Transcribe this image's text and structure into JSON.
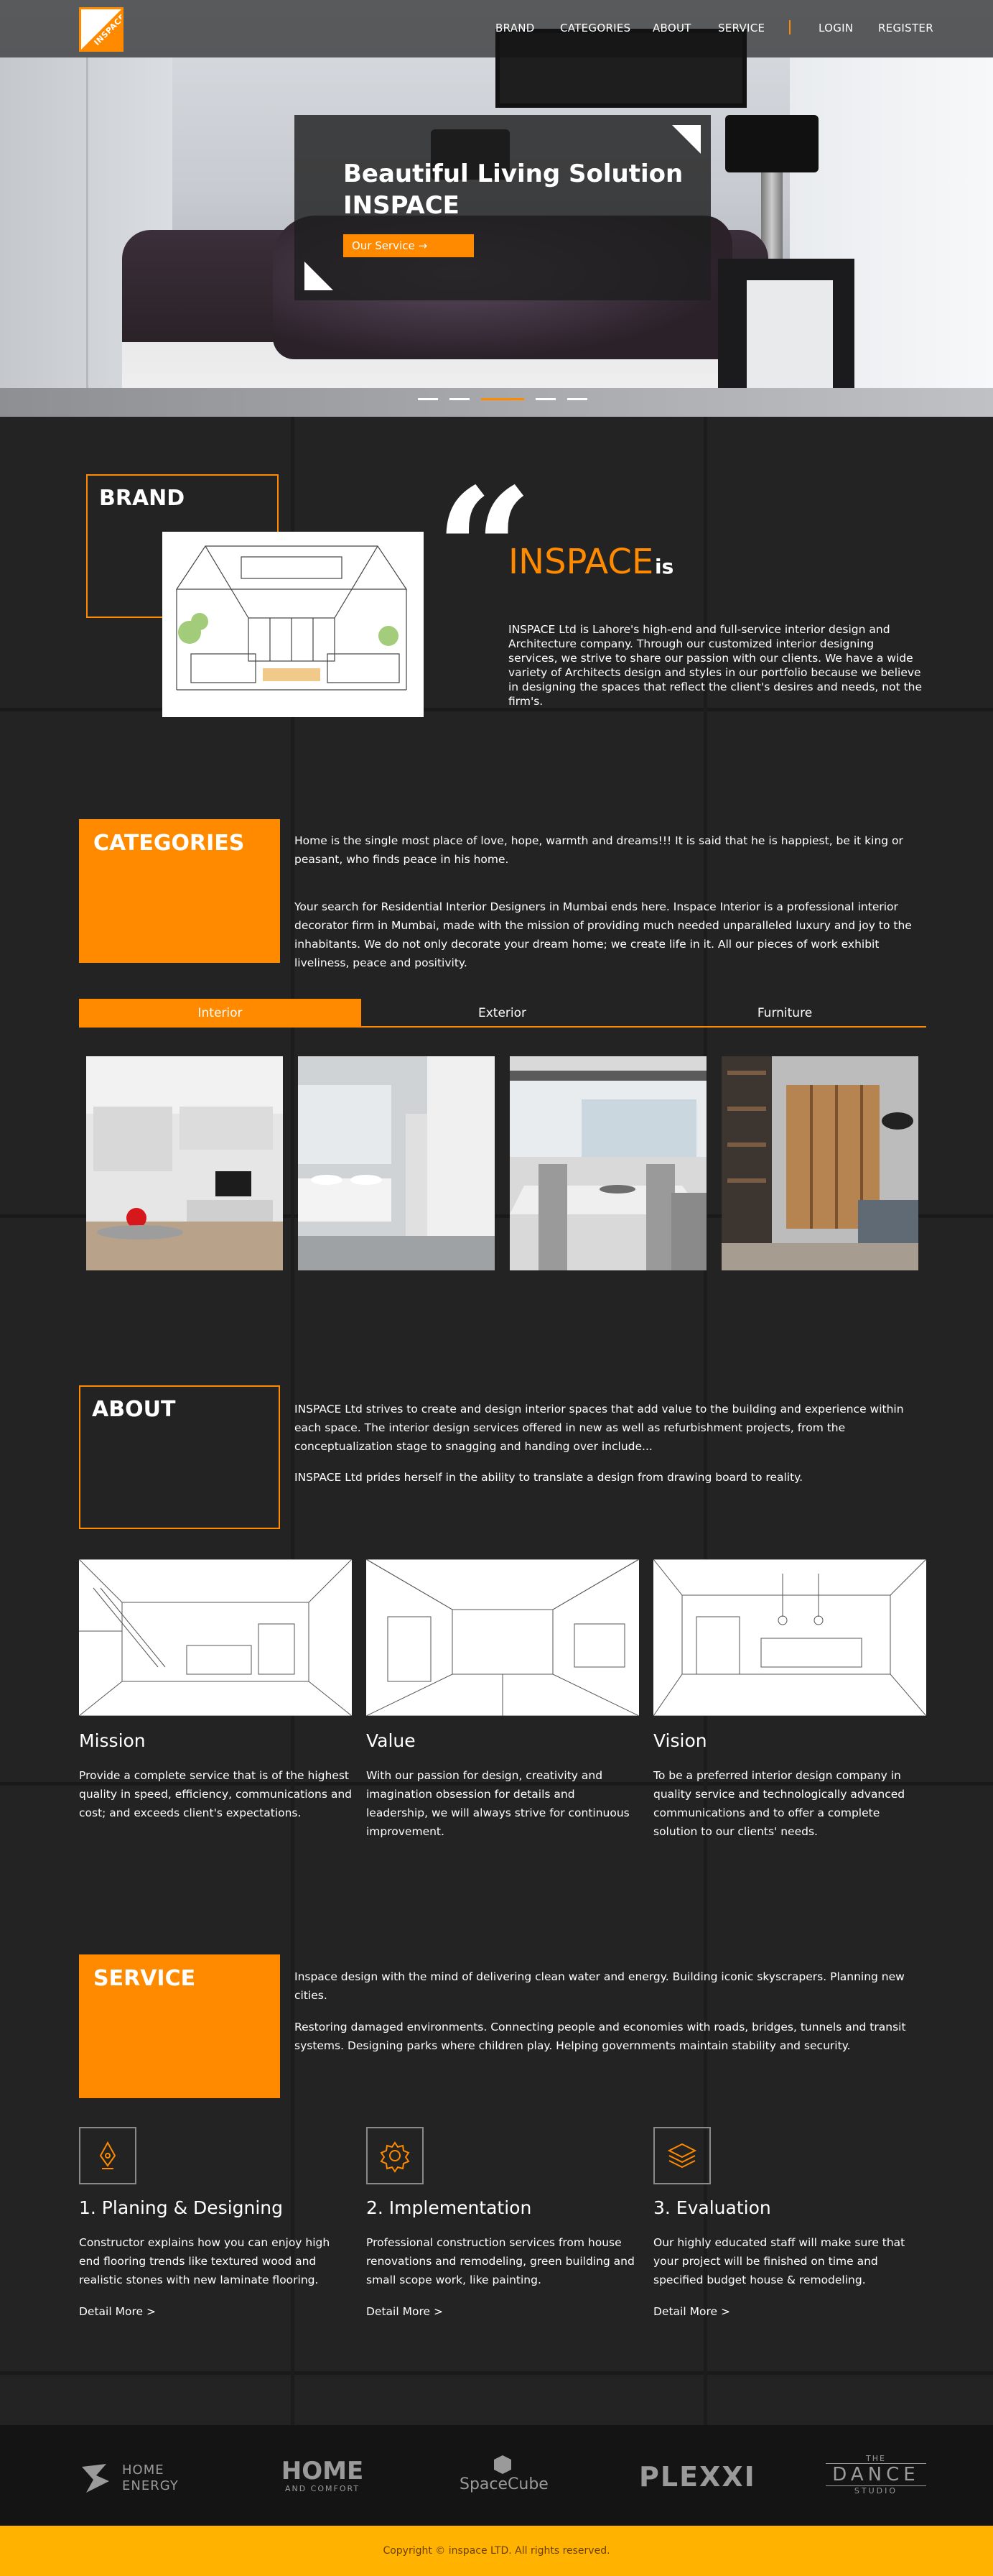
{
  "nav": {
    "logo_text": "INSPACE",
    "items": [
      "BRAND",
      "CATEGORIES",
      "ABOUT",
      "SERVICE"
    ],
    "auth": [
      "LOGIN",
      "REGISTER"
    ]
  },
  "hero": {
    "title_line1": "Beautiful Living Solution",
    "title_line2": "INSPACE",
    "button": "Our Service →",
    "slides": 5,
    "active_slide": 3
  },
  "brand": {
    "label": "BRAND",
    "quote_mark": "“",
    "name": "INSPACE",
    "is": "is",
    "text": "INSPACE Ltd is Lahore's high-end and full-service interior design and Architecture company. Through our customized interior designing services, we strive to share our passion with our clients. We have a wide variety of Architects design and styles in our portfolio because we believe in designing the spaces that reflect the client's desires and needs, not the firm's."
  },
  "categories": {
    "title": "CATEGORIES",
    "para1": "Home is the single most place of love, hope, warmth and dreams!!! It is said that he is happiest, be it king or peasant, who finds peace in his home.",
    "para2": "Your search for Residential Interior Designers in Mumbai ends here. Inspace Interior is a professional interior decorator firm in Mumbai, made with the mission of providing much needed unparalleled luxury and joy to the inhabitants. We do not only decorate your dream home; we create life in it. All our pieces of work exhibit liveliness, peace and positivity.",
    "tabs": [
      "Interior",
      "Exterior",
      "Furniture"
    ],
    "active_tab": "Interior"
  },
  "about": {
    "title": "ABOUT",
    "para1": "INSPACE Ltd strives to create and design interior spaces that add value to the building and experience within each space. The interior design services offered in new as well as refurbishment projects, from the conceptualization stage to snagging and handing over include...",
    "para2": "INSPACE Ltd prides herself in the ability to translate a design from drawing board to reality.",
    "columns": [
      {
        "title": "Mission",
        "text": "Provide a complete service that is of the highest quality in speed, efficiency, communications and cost; and exceeds client's expectations."
      },
      {
        "title": "Value",
        "text": "With our passion for design, creativity and imagination obsession for details and leadership, we will always strive for continuous improvement."
      },
      {
        "title": "Vision",
        "text": "To be a preferred interior design company in quality service and technologically advanced communications and to offer a complete solution to our clients' needs."
      }
    ]
  },
  "service": {
    "title": "SERVICE",
    "para1": "Inspace design with the mind of delivering clean water and energy. Building iconic skyscrapers. Planning new cities.",
    "para2": "Restoring damaged environments. Connecting people and economies with roads, bridges, tunnels and transit systems. Designing parks where children play. Helping governments maintain stability and security.",
    "items": [
      {
        "icon": "pen-nib-icon",
        "title": "1. Planing & Designing",
        "text": "Constructor explains how you can enjoy high end flooring trends like textured wood and realistic stones with new laminate flooring.",
        "link": "Detail More  >"
      },
      {
        "icon": "gear-icon",
        "title": "2. Implementation",
        "text": "Professional construction services from house renovations and remodeling, green building and small scope work, like painting.",
        "link": "Detail More  >"
      },
      {
        "icon": "layers-icon",
        "title": "3. Evaluation",
        "text": "Our highly educated staff will make sure that your project will be finished on time and specified budget house & remodeling.",
        "link": "Detail More  >"
      }
    ]
  },
  "partners": {
    "home_energy": [
      "HOME",
      "ENERGY"
    ],
    "home_comfort": [
      "HOME",
      "AND COMFORT"
    ],
    "spacecube": "SpaceCube",
    "plexxi": "PLEXXI",
    "dance": [
      "THE",
      "DANCE",
      "STUDIO"
    ]
  },
  "footer": {
    "copyright": "Copyright © inspace LTD. All rights reserved."
  },
  "colors": {
    "accent": "#ff8a00",
    "background": "#232323",
    "footer": "#ffb300"
  }
}
